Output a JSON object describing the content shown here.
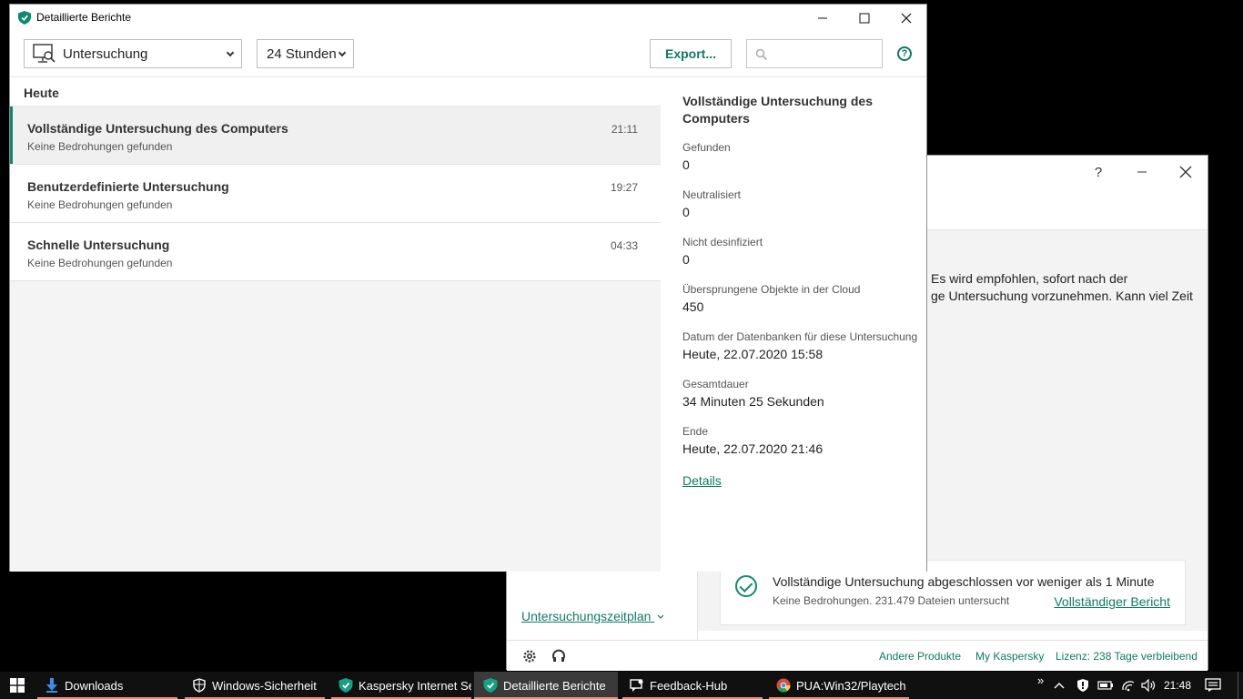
{
  "background_window": {
    "help_label": "?",
    "recommendation_text_line1": "Es wird empfohlen, sofort nach der",
    "recommendation_text_line2": "ge Untersuchung vorzunehmen. Kann viel Zeit",
    "notice": {
      "title": "Vollständige Untersuchung abgeschlossen vor weniger als 1 Minute",
      "subtitle": "Keine Bedrohungen. 231.479 Dateien untersucht",
      "link": "Vollständiger Bericht"
    },
    "schedule_link": "Untersuchungszeitplan",
    "footer": {
      "other_products": "Andere Produkte",
      "my_kaspersky": "My Kaspersky",
      "license": "Lizenz: 238 Tage verbleibend"
    }
  },
  "main_window": {
    "title": "Detaillierte Berichte",
    "toolbar": {
      "category": "Untersuchung",
      "period": "24 Stunden",
      "export_label": "Export...",
      "search_placeholder": "",
      "help_label": "?"
    },
    "list": {
      "group_header": "Heute",
      "items": [
        {
          "title": "Vollständige Untersuchung des Computers",
          "subtitle": "Keine Bedrohungen gefunden",
          "time": "21:11"
        },
        {
          "title": "Benutzerdefinierte Untersuchung",
          "subtitle": "Keine Bedrohungen gefunden",
          "time": "19:27"
        },
        {
          "title": "Schnelle Untersuchung",
          "subtitle": "Keine Bedrohungen gefunden",
          "time": "04:33"
        }
      ]
    },
    "detail": {
      "title": "Vollständige Untersuchung des Computers",
      "fields": [
        {
          "label": "Gefunden",
          "value": "0"
        },
        {
          "label": "Neutralisiert",
          "value": "0"
        },
        {
          "label": "Nicht desinfiziert",
          "value": "0"
        },
        {
          "label": "Übersprungene Objekte in der Cloud",
          "value": "450"
        },
        {
          "label": "Datum der Datenbanken für diese Untersuchung",
          "value": "Heute, 22.07.2020 15:58"
        },
        {
          "label": "Gesamtdauer",
          "value": "34 Minuten 25 Sekunden"
        },
        {
          "label": "Ende",
          "value": "Heute, 22.07.2020 21:46"
        }
      ],
      "details_link": "Details"
    }
  },
  "taskbar": {
    "items": [
      {
        "label": "Downloads",
        "icon": "download-arrow-icon"
      },
      {
        "label": "Windows-Sicherheit",
        "icon": "shield-icon"
      },
      {
        "label": "Kaspersky Internet Se...",
        "icon": "kaspersky-shield-icon"
      },
      {
        "label": "Detaillierte Berichte",
        "icon": "kaspersky-shield-icon"
      },
      {
        "label": "Feedback-Hub",
        "icon": "feedback-icon"
      },
      {
        "label": "PUA:Win32/Playtech ...",
        "icon": "chrome-icon"
      }
    ],
    "clock": "21:48",
    "overflow_label": "»"
  },
  "colors": {
    "accent": "#0f7a63",
    "selection_bar": "#0f8a6f",
    "taskbar": "#101010",
    "taskbar_indicator": "#e88e7e"
  }
}
